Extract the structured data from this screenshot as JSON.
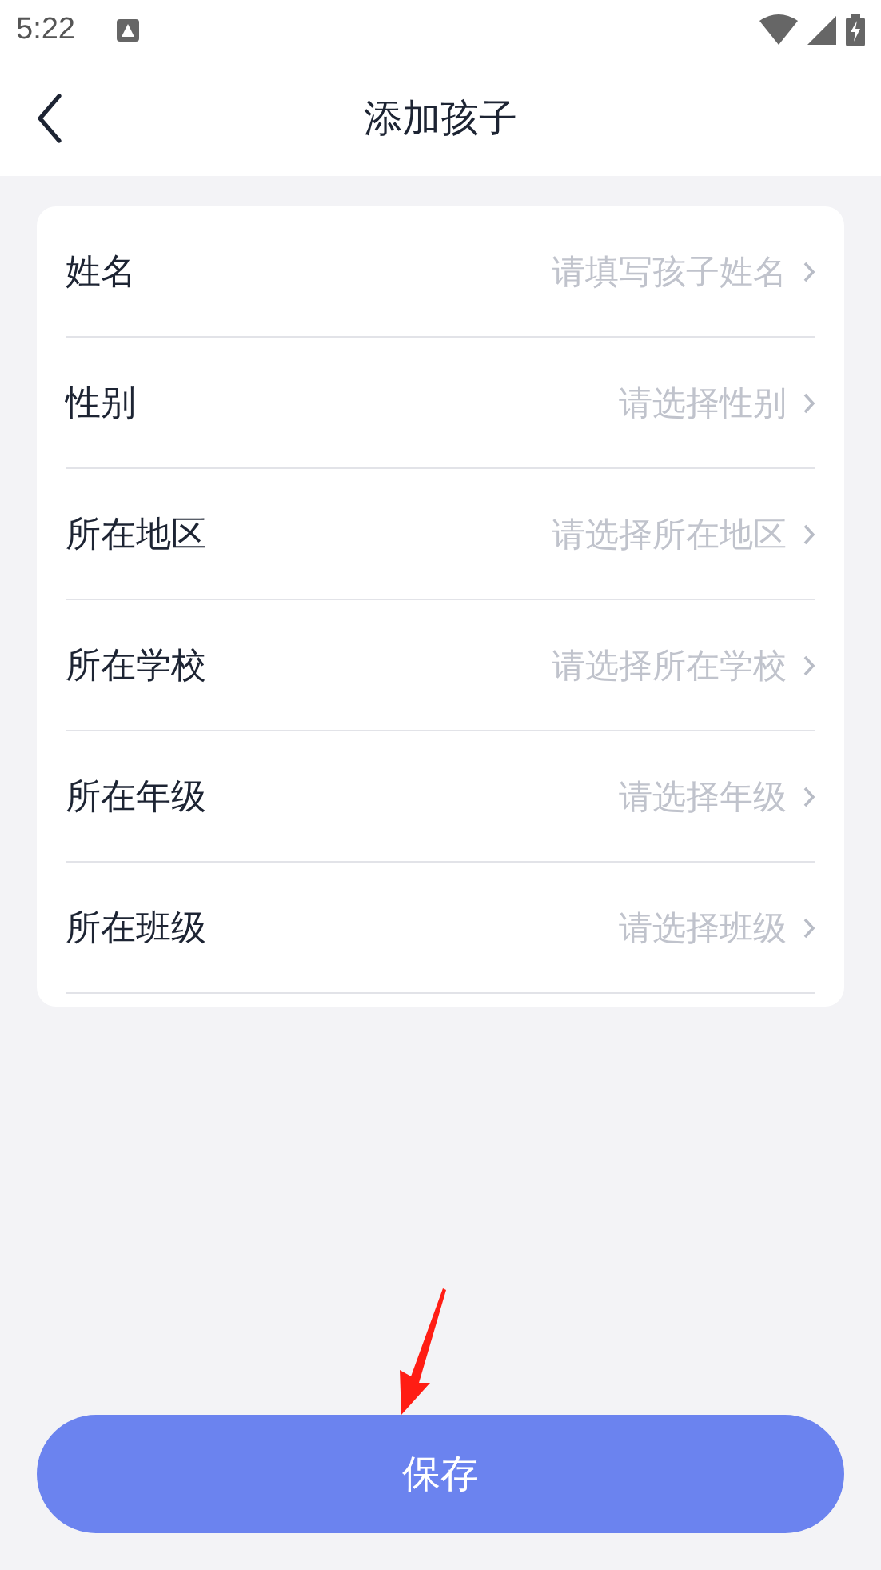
{
  "status_bar": {
    "time": "5:22"
  },
  "header": {
    "title": "添加孩子"
  },
  "form": {
    "rows": [
      {
        "label": "姓名",
        "placeholder": "请填写孩子姓名"
      },
      {
        "label": "性别",
        "placeholder": "请选择性别"
      },
      {
        "label": "所在地区",
        "placeholder": "请选择所在地区"
      },
      {
        "label": "所在学校",
        "placeholder": "请选择所在学校"
      },
      {
        "label": "所在年级",
        "placeholder": "请选择年级"
      },
      {
        "label": "所在班级",
        "placeholder": "请选择班级"
      }
    ]
  },
  "save_button": {
    "label": "保存"
  }
}
